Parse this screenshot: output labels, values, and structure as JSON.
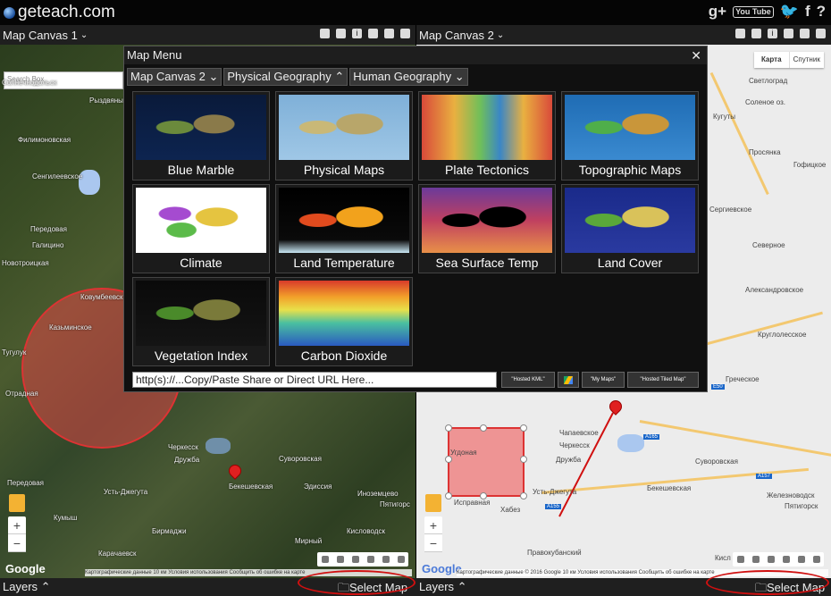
{
  "app": {
    "logo_text": "geteach.com",
    "social": [
      "g+",
      "You Tube",
      "twitter",
      "f",
      "?"
    ]
  },
  "canvases": [
    {
      "title": "Map Canvas 1",
      "search_placeholder": "Search Box",
      "labels": [
        "Солнечнодольск",
        "Рыздвяный",
        "Филимоновская",
        "Сенгилеевское",
        "Передовая",
        "Галицино",
        "Новотроицкая",
        "Ковумбеевское",
        "Казьминское",
        "Тугулук",
        "Отрадная",
        "Черкесск",
        "Дружба",
        "Суворовская",
        "Бекешевская",
        "Усть-Джегута",
        "Эдиссия",
        "Пятигорс",
        "Передовая",
        "Кисловодск",
        "Иноземцево",
        "Мирный",
        "Кумыш",
        "Бирмаджи",
        "Карачаевск"
      ],
      "google": "Google",
      "attribution": "Картографические данные   10 км    Условия использования   Сообщить об ошибке на карте"
    },
    {
      "title": "Map Canvas 2",
      "map_type": [
        "Карта",
        "Спутник"
      ],
      "labels": [
        "Светлоград",
        "Соленое оз.",
        "Кугуты",
        "Просянка",
        "Гофицкое",
        "Сергиевское",
        "Северное",
        "Александровское",
        "Круглолесское",
        "Греческое",
        "Усть-Джегута",
        "Чапаевское",
        "Дружба",
        "Черкесск",
        "Суворовская",
        "Бекешевская",
        "Хабез",
        "Исправная",
        "Железноводск",
        "Пятигорск",
        "Правокубанский",
        "Кисл",
        "Угдоная"
      ],
      "highway_badges": [
        "A165",
        "A155",
        "A157",
        "E50"
      ],
      "google": "Google",
      "attribution": "Картографические данные © 2016 Google   10 км    Условия использования   Сообщить об ошибке на карте"
    }
  ],
  "menu": {
    "title": "Map Menu",
    "close": "✕",
    "tabs": [
      "Map Canvas 2",
      "Physical Geography",
      "Human Geography"
    ],
    "tab_chevrons": [
      "⌄",
      "⌃",
      "⌄"
    ],
    "tiles": [
      {
        "label": "Blue Marble",
        "thumb": "blue-marble"
      },
      {
        "label": "Physical Maps",
        "thumb": "physical"
      },
      {
        "label": "Plate Tectonics",
        "thumb": "tectonics"
      },
      {
        "label": "Topographic Maps",
        "thumb": "topographic"
      },
      {
        "label": "Climate",
        "thumb": "climate"
      },
      {
        "label": "Land Temperature",
        "thumb": "land-temp"
      },
      {
        "label": "Sea Surface Temp",
        "thumb": "sst"
      },
      {
        "label": "Land Cover",
        "thumb": "land-cover"
      },
      {
        "label": "Vegetation Index",
        "thumb": "vegetation"
      },
      {
        "label": "Carbon Dioxide",
        "thumb": "co2"
      }
    ],
    "url_placeholder": "http(s)://...Copy/Paste Share or Direct URL Here...",
    "buttons": [
      "\"Hosted KML\"",
      "\"My Maps\"",
      "\"Hosted Tiled Map\""
    ]
  },
  "bottom": {
    "layers_label": "Layers",
    "select_map_label": "Select Map"
  },
  "colors": {
    "annotation_red": "#d01010",
    "polygon_fill": "#e85a5a"
  }
}
